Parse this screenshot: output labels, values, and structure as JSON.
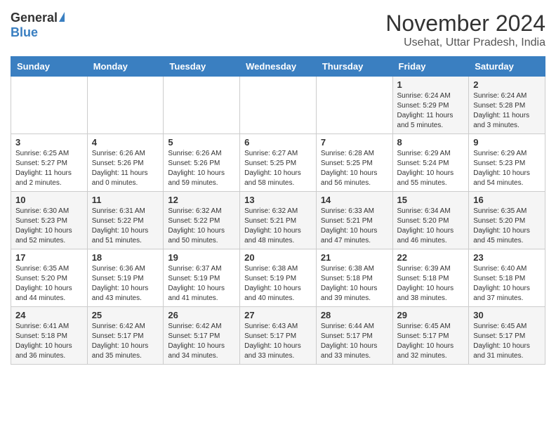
{
  "header": {
    "logo_general": "General",
    "logo_blue": "Blue",
    "month_year": "November 2024",
    "location": "Usehat, Uttar Pradesh, India"
  },
  "days_of_week": [
    "Sunday",
    "Monday",
    "Tuesday",
    "Wednesday",
    "Thursday",
    "Friday",
    "Saturday"
  ],
  "weeks": [
    [
      {
        "day": "",
        "info": ""
      },
      {
        "day": "",
        "info": ""
      },
      {
        "day": "",
        "info": ""
      },
      {
        "day": "",
        "info": ""
      },
      {
        "day": "",
        "info": ""
      },
      {
        "day": "1",
        "info": "Sunrise: 6:24 AM\nSunset: 5:29 PM\nDaylight: 11 hours and 5 minutes."
      },
      {
        "day": "2",
        "info": "Sunrise: 6:24 AM\nSunset: 5:28 PM\nDaylight: 11 hours and 3 minutes."
      }
    ],
    [
      {
        "day": "3",
        "info": "Sunrise: 6:25 AM\nSunset: 5:27 PM\nDaylight: 11 hours and 2 minutes."
      },
      {
        "day": "4",
        "info": "Sunrise: 6:26 AM\nSunset: 5:26 PM\nDaylight: 11 hours and 0 minutes."
      },
      {
        "day": "5",
        "info": "Sunrise: 6:26 AM\nSunset: 5:26 PM\nDaylight: 10 hours and 59 minutes."
      },
      {
        "day": "6",
        "info": "Sunrise: 6:27 AM\nSunset: 5:25 PM\nDaylight: 10 hours and 58 minutes."
      },
      {
        "day": "7",
        "info": "Sunrise: 6:28 AM\nSunset: 5:25 PM\nDaylight: 10 hours and 56 minutes."
      },
      {
        "day": "8",
        "info": "Sunrise: 6:29 AM\nSunset: 5:24 PM\nDaylight: 10 hours and 55 minutes."
      },
      {
        "day": "9",
        "info": "Sunrise: 6:29 AM\nSunset: 5:23 PM\nDaylight: 10 hours and 54 minutes."
      }
    ],
    [
      {
        "day": "10",
        "info": "Sunrise: 6:30 AM\nSunset: 5:23 PM\nDaylight: 10 hours and 52 minutes."
      },
      {
        "day": "11",
        "info": "Sunrise: 6:31 AM\nSunset: 5:22 PM\nDaylight: 10 hours and 51 minutes."
      },
      {
        "day": "12",
        "info": "Sunrise: 6:32 AM\nSunset: 5:22 PM\nDaylight: 10 hours and 50 minutes."
      },
      {
        "day": "13",
        "info": "Sunrise: 6:32 AM\nSunset: 5:21 PM\nDaylight: 10 hours and 48 minutes."
      },
      {
        "day": "14",
        "info": "Sunrise: 6:33 AM\nSunset: 5:21 PM\nDaylight: 10 hours and 47 minutes."
      },
      {
        "day": "15",
        "info": "Sunrise: 6:34 AM\nSunset: 5:20 PM\nDaylight: 10 hours and 46 minutes."
      },
      {
        "day": "16",
        "info": "Sunrise: 6:35 AM\nSunset: 5:20 PM\nDaylight: 10 hours and 45 minutes."
      }
    ],
    [
      {
        "day": "17",
        "info": "Sunrise: 6:35 AM\nSunset: 5:20 PM\nDaylight: 10 hours and 44 minutes."
      },
      {
        "day": "18",
        "info": "Sunrise: 6:36 AM\nSunset: 5:19 PM\nDaylight: 10 hours and 43 minutes."
      },
      {
        "day": "19",
        "info": "Sunrise: 6:37 AM\nSunset: 5:19 PM\nDaylight: 10 hours and 41 minutes."
      },
      {
        "day": "20",
        "info": "Sunrise: 6:38 AM\nSunset: 5:19 PM\nDaylight: 10 hours and 40 minutes."
      },
      {
        "day": "21",
        "info": "Sunrise: 6:38 AM\nSunset: 5:18 PM\nDaylight: 10 hours and 39 minutes."
      },
      {
        "day": "22",
        "info": "Sunrise: 6:39 AM\nSunset: 5:18 PM\nDaylight: 10 hours and 38 minutes."
      },
      {
        "day": "23",
        "info": "Sunrise: 6:40 AM\nSunset: 5:18 PM\nDaylight: 10 hours and 37 minutes."
      }
    ],
    [
      {
        "day": "24",
        "info": "Sunrise: 6:41 AM\nSunset: 5:18 PM\nDaylight: 10 hours and 36 minutes."
      },
      {
        "day": "25",
        "info": "Sunrise: 6:42 AM\nSunset: 5:17 PM\nDaylight: 10 hours and 35 minutes."
      },
      {
        "day": "26",
        "info": "Sunrise: 6:42 AM\nSunset: 5:17 PM\nDaylight: 10 hours and 34 minutes."
      },
      {
        "day": "27",
        "info": "Sunrise: 6:43 AM\nSunset: 5:17 PM\nDaylight: 10 hours and 33 minutes."
      },
      {
        "day": "28",
        "info": "Sunrise: 6:44 AM\nSunset: 5:17 PM\nDaylight: 10 hours and 33 minutes."
      },
      {
        "day": "29",
        "info": "Sunrise: 6:45 AM\nSunset: 5:17 PM\nDaylight: 10 hours and 32 minutes."
      },
      {
        "day": "30",
        "info": "Sunrise: 6:45 AM\nSunset: 5:17 PM\nDaylight: 10 hours and 31 minutes."
      }
    ]
  ]
}
